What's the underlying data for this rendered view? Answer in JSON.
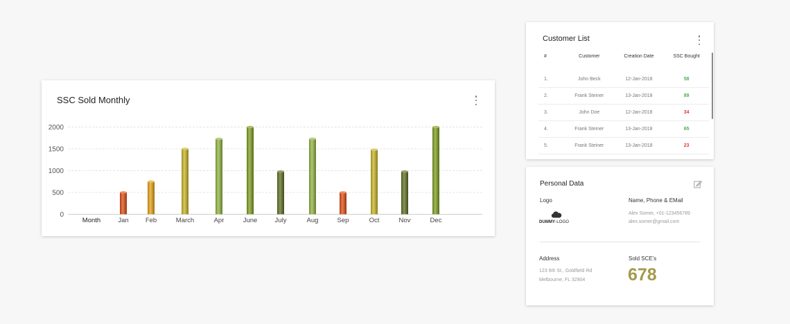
{
  "chart_card": {
    "title": "SSC Sold Monthly",
    "menu_icon": "more-vertical-icon"
  },
  "chart_data": {
    "type": "bar",
    "xlabel": "Month",
    "categories": [
      "Jan",
      "Feb",
      "March",
      "Apr",
      "June",
      "July",
      "Aug",
      "Sep",
      "Oct",
      "Nov",
      "Dec"
    ],
    "values": [
      500,
      750,
      1500,
      1730,
      2000,
      980,
      1730,
      500,
      1480,
      980,
      2000
    ],
    "colors": [
      "#dd4a10",
      "#e3a012",
      "#c8b222",
      "#8fb33e",
      "#7c9c1c",
      "#5a6d1e",
      "#8fb33e",
      "#dd4a10",
      "#c8b222",
      "#5a6d1e",
      "#7c9c1c"
    ],
    "y_ticks": [
      "0",
      "500",
      "1000",
      "1500",
      "2000"
    ],
    "ylim": [
      0,
      2000
    ],
    "grid": true
  },
  "customer_list": {
    "title": "Customer List",
    "menu_icon": "more-vertical-icon",
    "columns": [
      "#",
      "Customer",
      "Creation Date",
      "SSC Bought"
    ],
    "rows": [
      {
        "num": "1.",
        "customer": "John Beck",
        "date": "12-Jan-2018",
        "bought": "58",
        "color": "#4caf50"
      },
      {
        "num": "2.",
        "customer": "Frank Steiner",
        "date": "13-Jan-2018",
        "bought": "89",
        "color": "#4caf50"
      },
      {
        "num": "3.",
        "customer": "John Doe",
        "date": "12-Jan-2018",
        "bought": "34",
        "color": "#e53935"
      },
      {
        "num": "4.",
        "customer": "Frank Steiner",
        "date": "13-Jan-2018",
        "bought": "65",
        "color": "#4caf50"
      },
      {
        "num": "5.",
        "customer": "Frank Steiner",
        "date": "13-Jan-2018",
        "bought": "23",
        "color": "#e53935"
      }
    ]
  },
  "personal_data": {
    "title": "Personal Data",
    "edit_icon": "edit-icon",
    "logo_label": "Logo",
    "logo_text_bold": "DUMMY",
    "logo_text_light": "-LOGO",
    "contact_label": "Name, Phone & EMail",
    "contact_line1": "Alex Somer, +01-123456789",
    "contact_line2": "alex.somer@gmail.com",
    "address_label": "Address",
    "address_line1": "123 6th St., Goldfield Rd",
    "address_line2": "Melbourne, FL 32904",
    "sold_label": "Sold SCE's",
    "sold_value": "678",
    "accent_color": "#a39b4a"
  }
}
